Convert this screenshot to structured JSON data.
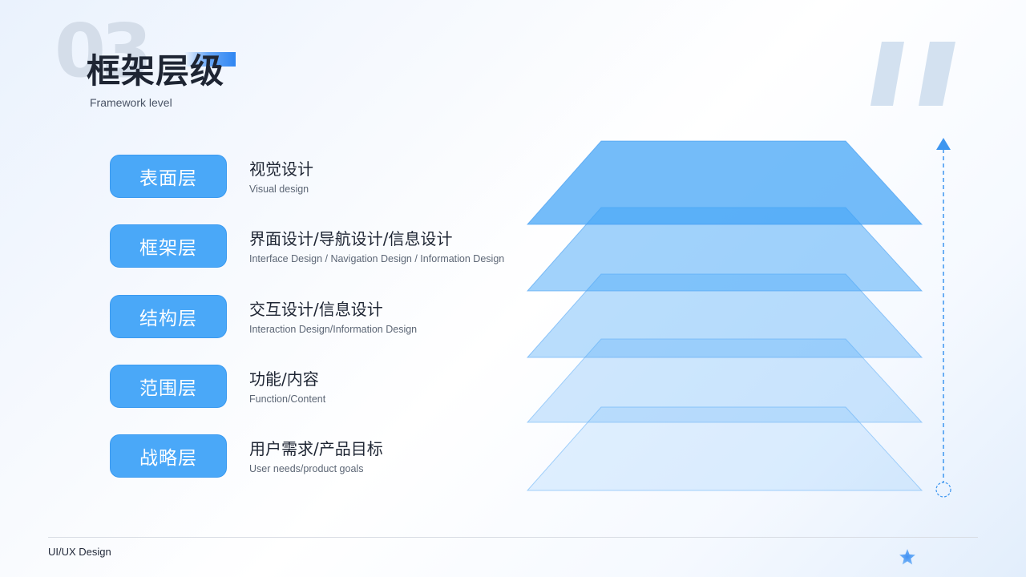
{
  "header": {
    "section_number": "03",
    "title": "框架层级",
    "subtitle": "Framework level"
  },
  "layers": [
    {
      "label": "表面层",
      "name": "视觉设计",
      "desc": "Visual design"
    },
    {
      "label": "框架层",
      "name": "界面设计/导航设计/信息设计",
      "desc": "Interface Design / Navigation Design / Information Design"
    },
    {
      "label": "结构层",
      "name": "交互设计/信息设计",
      "desc": "Interaction Design/Information Design"
    },
    {
      "label": "范围层",
      "name": "功能/内容",
      "desc": "Function/Content"
    },
    {
      "label": "战略层",
      "name": "用户需求/产品目标",
      "desc": "User needs/product goals"
    }
  ],
  "footer": {
    "label": "UI/UX Design"
  },
  "colors": {
    "accent": "#4aa8f8",
    "accent_dark": "#2f86f2",
    "quote_mark": "#d3e1f0",
    "arrow": "#3d96f0"
  },
  "icons": {
    "quote": "quote-mark-icon",
    "arrow": "up-arrow-icon",
    "star": "star-icon"
  }
}
